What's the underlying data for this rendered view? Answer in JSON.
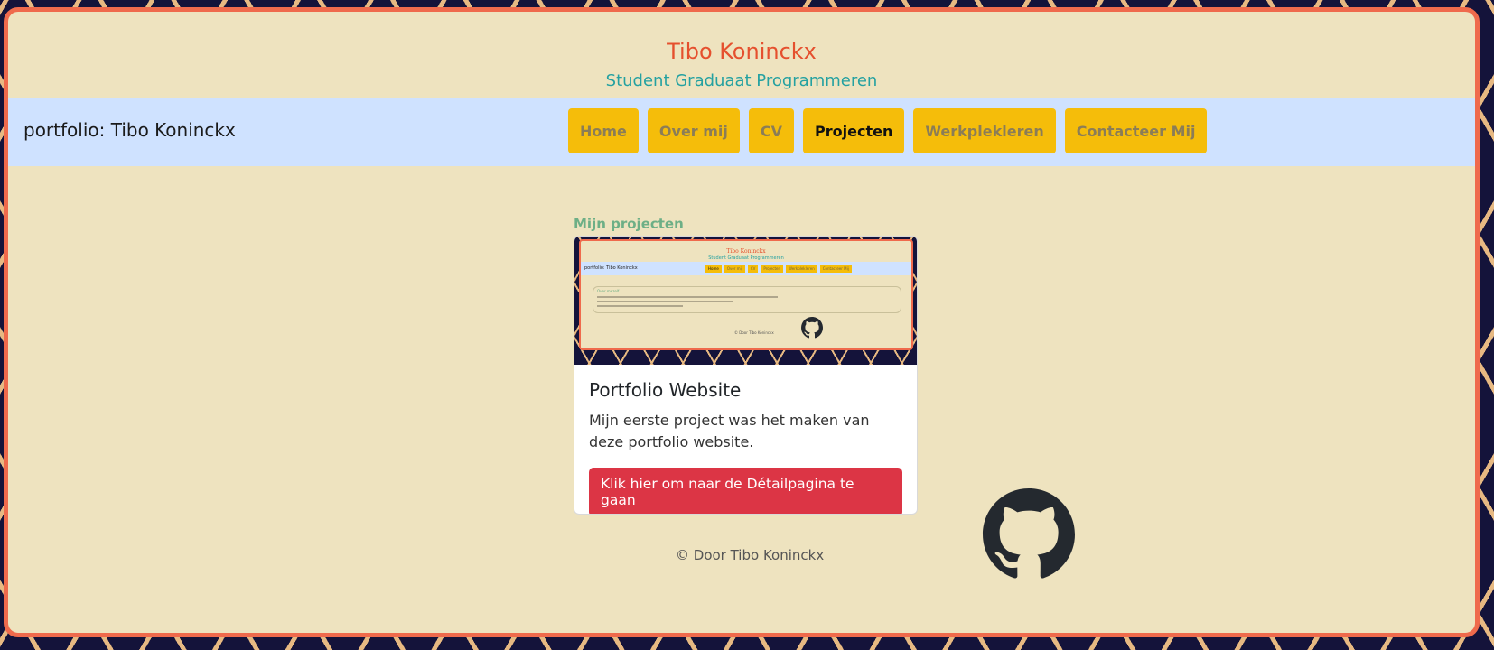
{
  "site": {
    "title": "Tibo Koninckx",
    "subtitle": "Student Graduaat Programmeren"
  },
  "navbar": {
    "brand": "portfolio: Tibo Koninckx",
    "items": [
      {
        "label": "Home",
        "active": false
      },
      {
        "label": "Over mij",
        "active": false
      },
      {
        "label": "CV",
        "active": false
      },
      {
        "label": "Projecten",
        "active": true
      },
      {
        "label": "Werkplekleren",
        "active": false
      },
      {
        "label": "Contacteer Mij",
        "active": false
      }
    ]
  },
  "main": {
    "section_title": "Mijn projecten",
    "card": {
      "title": "Portfolio Website",
      "text": "Mijn eerste project was het maken van deze portfolio website.",
      "button_label": "Klik hier om naar de Détailpagina te gaan",
      "screenshot": {
        "title": "Tibo Koninckx",
        "subtitle": "Student Graduaat Programmeren",
        "brand": "portfolio: Tibo Koninckx",
        "nav_items": [
          "Home",
          "Over mij",
          "CV",
          "Projecten",
          "Werkplekleren",
          "Contacteer Mij"
        ],
        "section_title": "Over mezelf",
        "footer": "© Door Tibo Koninckx"
      }
    }
  },
  "footer": {
    "copyright": "© Door Tibo Koninckx",
    "github_icon": "github-icon"
  },
  "colors": {
    "frame_border": "#ef6a4c",
    "frame_background": "#eee3bf",
    "title": "#e5502e",
    "subtitle": "#24a1a1",
    "navbar_background": "#cfe2ff",
    "nav_button": "#f5bd0a",
    "section_title": "#6daf86",
    "card_button": "#dc3545"
  }
}
